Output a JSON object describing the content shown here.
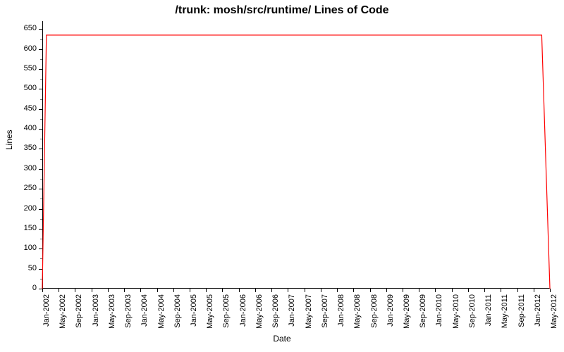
{
  "chart_data": {
    "type": "line",
    "title": "/trunk: mosh/src/runtime/ Lines of Code",
    "xlabel": "Date",
    "ylabel": "Lines",
    "ylim": [
      0,
      670
    ],
    "y_ticks": [
      0,
      50,
      100,
      150,
      200,
      250,
      300,
      350,
      400,
      450,
      500,
      550,
      600,
      650
    ],
    "x_ticks": [
      "Jan-2002",
      "May-2002",
      "Sep-2002",
      "Jan-2003",
      "May-2003",
      "Sep-2003",
      "Jan-2004",
      "May-2004",
      "Sep-2004",
      "Jan-2005",
      "May-2005",
      "Sep-2005",
      "Jan-2006",
      "May-2006",
      "Sep-2006",
      "Jan-2007",
      "May-2007",
      "Sep-2007",
      "Jan-2008",
      "May-2008",
      "Sep-2008",
      "Jan-2009",
      "May-2009",
      "Sep-2009",
      "Jan-2010",
      "May-2010",
      "Sep-2010",
      "Jan-2011",
      "May-2011",
      "Sep-2011",
      "Jan-2012",
      "May-2012"
    ],
    "series": [
      {
        "name": "Lines of Code",
        "color": "#ff0000",
        "x": [
          "Jan-2002",
          "Feb-2002",
          "Mar-2012",
          "May-2012"
        ],
        "values": [
          0,
          635,
          635,
          0
        ]
      }
    ]
  }
}
